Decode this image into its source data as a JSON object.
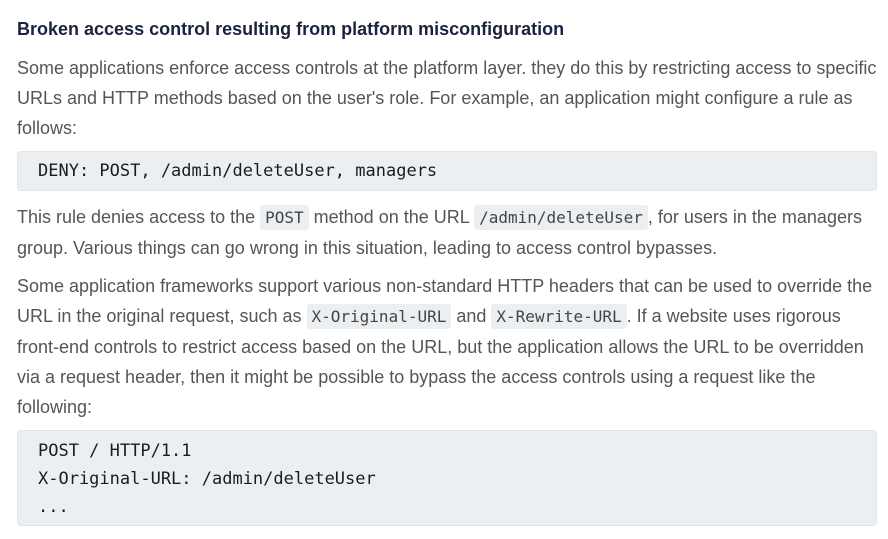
{
  "heading": "Broken access control resulting from platform misconfiguration",
  "para1": "Some applications enforce access controls at the platform layer. they do this by restricting access to specific URLs and HTTP methods based on the user's role. For example, an application might configure a rule as follows:",
  "code1": "DENY: POST, /admin/deleteUser, managers",
  "para2": {
    "t1": "This rule denies access to the ",
    "c1": "POST",
    "t2": " method on the URL ",
    "c2": "/admin/deleteUser",
    "t3": ", for users in the managers group. Various things can go wrong in this situation, leading to access control bypasses."
  },
  "para3": {
    "t1": "Some application frameworks support various non-standard HTTP headers that can be used to override the URL in the original request, such as ",
    "c1": "X-Original-URL",
    "t2": " and ",
    "c2": "X-Rewrite-URL",
    "t3": ". If a website uses rigorous front-end controls to restrict access based on the URL, but the application allows the URL to be overridden via a request header, then it might be possible to bypass the access controls using a request like the following:"
  },
  "code2": {
    "lines": [
      "POST / HTTP/1.1",
      "X-Original-URL: /admin/deleteUser",
      "..."
    ]
  }
}
